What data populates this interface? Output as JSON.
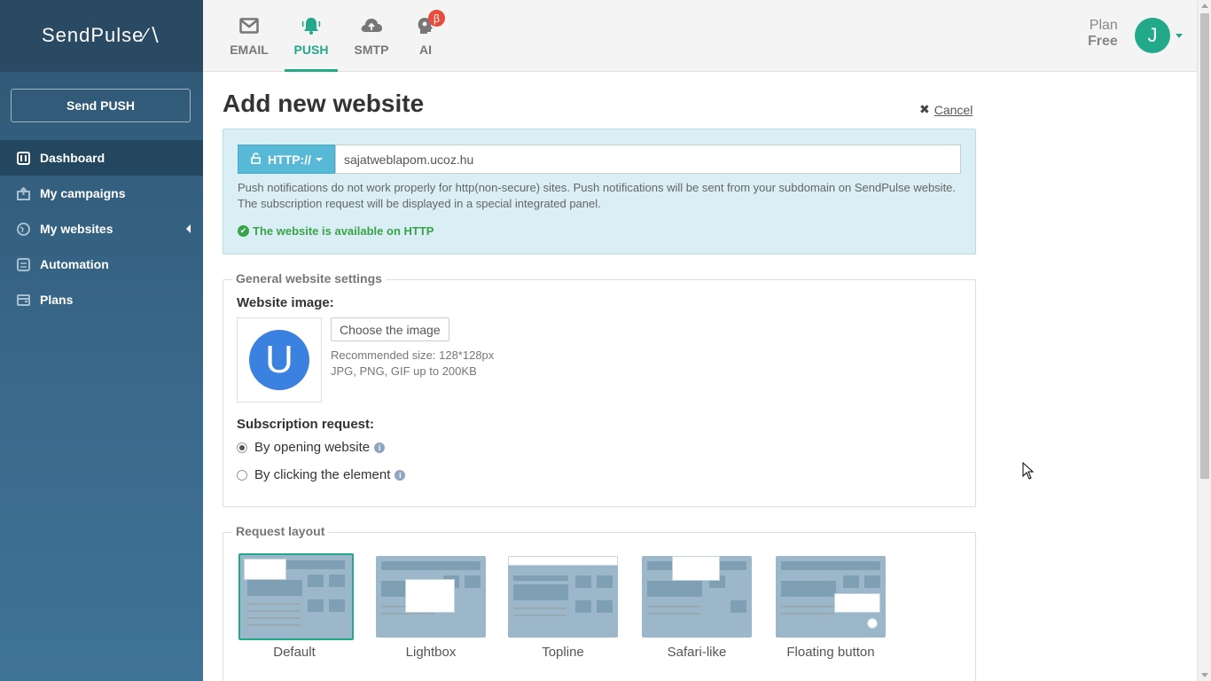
{
  "app": {
    "logo": "SendPulse∕∖"
  },
  "sidebar": {
    "send_button": "Send PUSH",
    "items": [
      {
        "label": "Dashboard",
        "icon": "dashboard-icon"
      },
      {
        "label": "My campaigns",
        "icon": "campaigns-icon"
      },
      {
        "label": "My websites",
        "icon": "websites-icon"
      },
      {
        "label": "Automation",
        "icon": "automation-icon"
      },
      {
        "label": "Plans",
        "icon": "plans-icon"
      }
    ]
  },
  "topbar": {
    "tabs": [
      {
        "label": "EMAIL",
        "icon": "envelope-icon"
      },
      {
        "label": "PUSH",
        "icon": "bell-icon"
      },
      {
        "label": "SMTP",
        "icon": "cloud-upload-icon"
      },
      {
        "label": "AI",
        "icon": "ai-head-icon",
        "badge": "β"
      }
    ],
    "active_tab": "PUSH",
    "plan_label": "Plan",
    "plan_value": "Free",
    "avatar_initial": "J"
  },
  "page": {
    "title": "Add new website",
    "cancel": "Cancel"
  },
  "http_box": {
    "protocol": "HTTP://",
    "url_value": "sajatweblapom.ucoz.hu",
    "note": "Push notifications do not work properly for http(non-secure) sites. Push notifications will be sent from your subdomain on SendPulse website. The subscription request will be displayed in a special integrated panel.",
    "status": "The website is available on HTTP"
  },
  "general": {
    "legend": "General website settings",
    "image_label": "Website image:",
    "image_initial": "U",
    "choose_button": "Choose the image",
    "hint_size": "Recommended size: 128*128px",
    "hint_formats": "JPG, PNG, GIF up to 200KB",
    "subscription_label": "Subscription request:",
    "options": [
      {
        "label": "By opening website",
        "selected": true
      },
      {
        "label": "By clicking the element",
        "selected": false
      }
    ]
  },
  "layout": {
    "legend": "Request layout",
    "options": [
      "Default",
      "Lightbox",
      "Topline",
      "Safari-like",
      "Floating button"
    ],
    "selected": "Default"
  },
  "colors": {
    "accent": "#22a88a",
    "sidebar": "#2f5673",
    "info_bg": "#d9eef5",
    "http_button": "#57b9d6"
  }
}
